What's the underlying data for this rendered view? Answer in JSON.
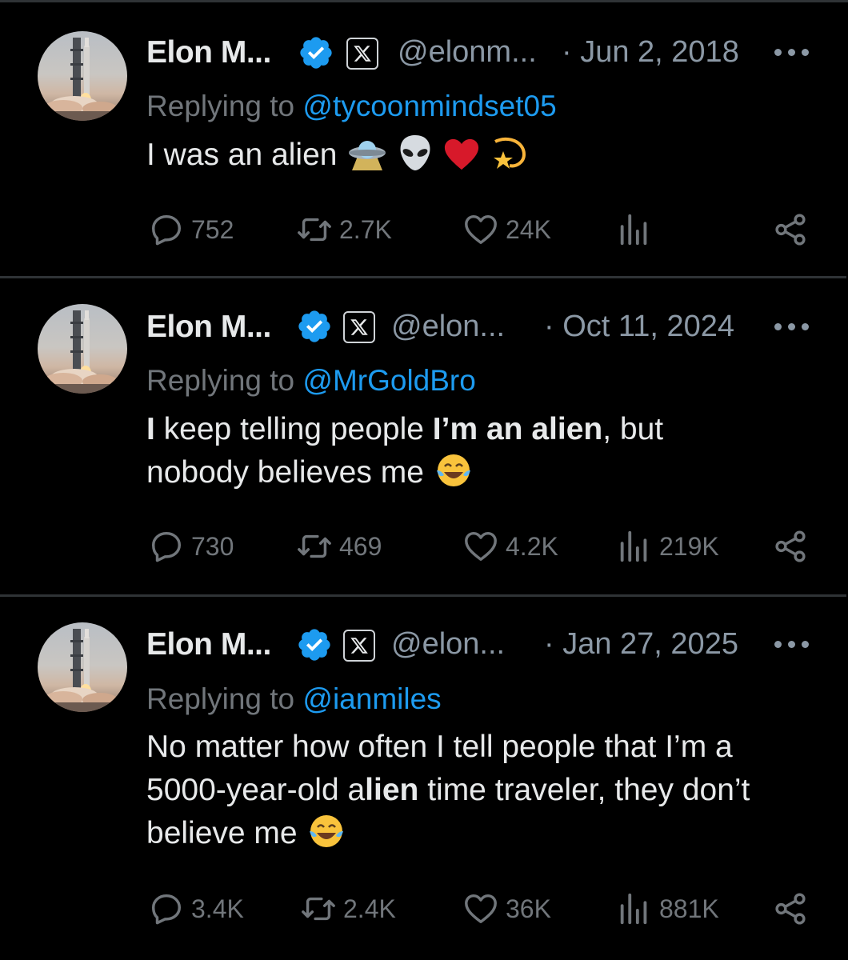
{
  "tweets": [
    {
      "display_name": "Elon M...",
      "handle": "@elonm...",
      "date": "· Jun 2, 2018",
      "replying_to_label": "Replying to",
      "replying_to": "@tycoonmindset05",
      "text": "I was an alien",
      "emojis": [
        "ufo-emoji",
        "alien-emoji",
        "red-heart-emoji",
        "dizzy-star-emoji"
      ],
      "replies": "752",
      "reposts": "2.7K",
      "likes": "24K",
      "views": ""
    },
    {
      "display_name": "Elon M...",
      "handle": "@elon...",
      "date": "· Oct 11, 2024",
      "replying_to_label": "Replying to",
      "replying_to": "@MrGoldBro",
      "text_parts": [
        "I",
        " keep telling people ",
        "I’m",
        " ",
        "an alien",
        ", but nobody believes me"
      ],
      "emojis": [
        "tears-of-joy-emoji"
      ],
      "replies": "730",
      "reposts": "469",
      "likes": "4.2K",
      "views": "219K"
    },
    {
      "display_name": "Elon M...",
      "handle": "@elon...",
      "date": "· Jan 27, 2025",
      "replying_to_label": "Replying to",
      "replying_to": "@ianmiles",
      "text_parts": [
        "No matter how often I tell people that I’m a 5000-year-old a",
        "lien",
        " time traveler, they don’t believe me"
      ],
      "emojis": [
        "tears-of-joy-emoji"
      ],
      "replies": "3.4K",
      "reposts": "2.4K",
      "likes": "36K",
      "views": "881K"
    }
  ],
  "colors": {
    "background": "#000000",
    "text": "#e7e9ea",
    "secondary": "#8b98a5",
    "muted": "#71767b",
    "mention": "#1d9bf0",
    "verified": "#1d9bf0",
    "divider": "#2f3336"
  },
  "icons": [
    "avatar-rocket",
    "verified-badge-icon",
    "x-logo-icon",
    "more-icon",
    "reply-icon",
    "repost-icon",
    "like-icon",
    "views-icon",
    "share-icon"
  ]
}
